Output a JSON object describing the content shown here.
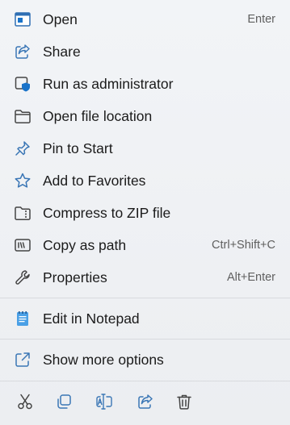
{
  "menu": {
    "items": [
      {
        "label": "Open",
        "shortcut": "Enter",
        "icon": "open-app-icon"
      },
      {
        "label": "Share",
        "icon": "share-icon"
      },
      {
        "label": "Run as administrator",
        "icon": "run-as-admin-icon"
      },
      {
        "label": "Open file location",
        "icon": "folder-icon"
      },
      {
        "label": "Pin to Start",
        "icon": "pin-icon"
      },
      {
        "label": "Add to Favorites",
        "icon": "star-icon"
      },
      {
        "label": "Compress to ZIP file",
        "icon": "zip-folder-icon"
      },
      {
        "label": "Copy as path",
        "shortcut": "Ctrl+Shift+C",
        "icon": "copy-path-icon"
      },
      {
        "label": "Properties",
        "shortcut": "Alt+Enter",
        "icon": "wrench-icon"
      },
      {
        "label": "Edit in Notepad",
        "icon": "notepad-icon"
      },
      {
        "label": "Show more options",
        "icon": "show-more-icon"
      }
    ]
  },
  "toolbar": {
    "icons": [
      "cut-icon",
      "copy-icon",
      "rename-icon",
      "share-icon",
      "delete-icon"
    ]
  },
  "colors": {
    "accent": "#1a73c9",
    "icon_stroke": "#3a76b5",
    "text": "#1b1b1b",
    "shortcut_text": "#5f5f5f",
    "background": "#eef0f3"
  }
}
